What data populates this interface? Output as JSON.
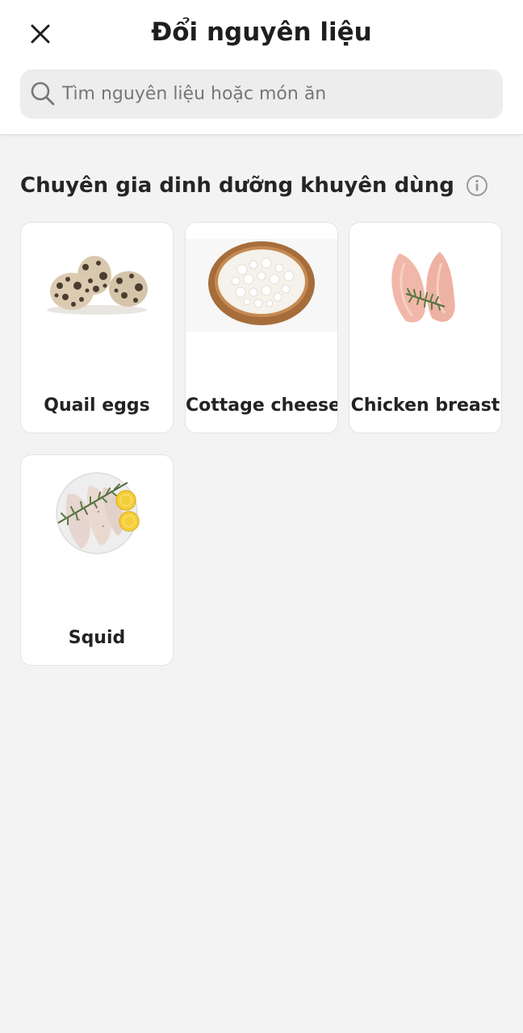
{
  "header": {
    "title": "Đổi nguyên liệu",
    "close_icon": "close-icon"
  },
  "search": {
    "placeholder": "Tìm nguyên liệu hoặc món ăn",
    "value": "",
    "icon": "search-icon"
  },
  "section": {
    "title": "Chuyên gia dinh dưỡng khuyên dùng",
    "info_icon": "info-icon"
  },
  "ingredients": [
    {
      "label": "Quail eggs"
    },
    {
      "label": "Cottage cheese"
    },
    {
      "label": "Chicken breast"
    },
    {
      "label": "Squid"
    }
  ]
}
